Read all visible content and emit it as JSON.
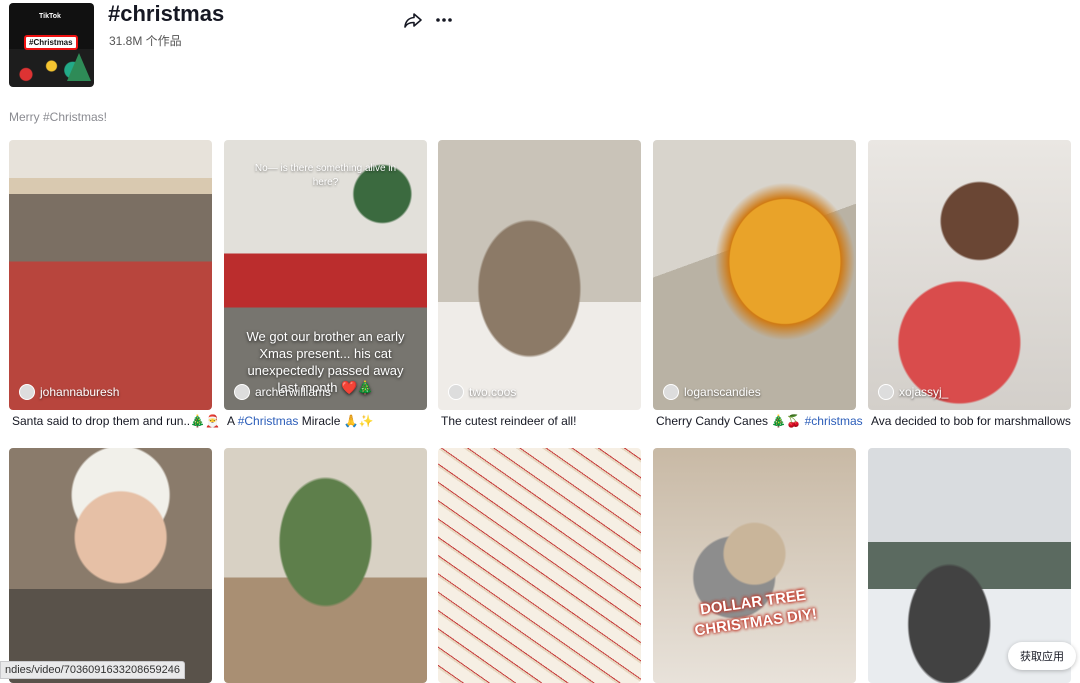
{
  "header": {
    "title": "#christmas",
    "count": "31.8M 个作品",
    "cover": {
      "brand": "TikTok",
      "tag": "#Christmas"
    },
    "description": "Merry #Christmas!"
  },
  "icons": {
    "share": "share-icon",
    "more": "more-icon"
  },
  "videos": [
    {
      "author": "johannaburesh",
      "caption": "Santa said to drop them and run..🎄🎅"
    },
    {
      "author": "archerwilliams",
      "caption_prefix": "A ",
      "caption_tag": "#Christmas",
      "caption_suffix": " Miracle 🙏✨",
      "overlay_top": "No— is there something alive in here?",
      "overlay_text": "We got our brother an early Xmas present... his cat unexpectedly passed away last month ❤️🎄"
    },
    {
      "author": "two.coos",
      "caption": "The cutest reindeer of all!"
    },
    {
      "author": "loganscandies",
      "caption_prefix": "Cherry Candy Canes 🎄🍒 ",
      "caption_tag": "#christmas"
    },
    {
      "author": "xojassyj_",
      "caption": "Ava decided to bob for marshmallows"
    },
    {},
    {},
    {},
    {
      "overlay_text": "DOLLAR TREE CHRISTMAS DIY!"
    },
    {}
  ],
  "status_url": "ndies/video/7036091633208659246",
  "get_app": "获取应用"
}
